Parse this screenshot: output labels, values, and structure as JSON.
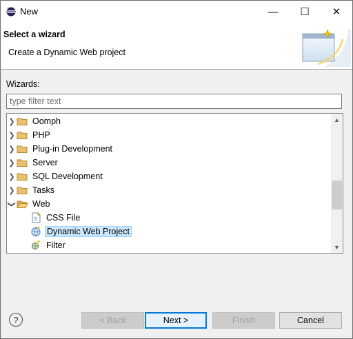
{
  "window": {
    "title": "New",
    "minimize": "—",
    "maximize": "☐",
    "close": "✕"
  },
  "banner": {
    "title": "Select a wizard",
    "message": "Create a Dynamic Web project"
  },
  "wizards_label": "Wizards:",
  "filter": {
    "placeholder": "type filter text",
    "value": ""
  },
  "tree": {
    "items": [
      {
        "label": "Oomph",
        "expanded": false,
        "icon": "folder-icon"
      },
      {
        "label": "PHP",
        "expanded": false,
        "icon": "folder-icon"
      },
      {
        "label": "Plug-in Development",
        "expanded": false,
        "icon": "folder-icon"
      },
      {
        "label": "Server",
        "expanded": false,
        "icon": "folder-icon"
      },
      {
        "label": "SQL Development",
        "expanded": false,
        "icon": "folder-icon"
      },
      {
        "label": "Tasks",
        "expanded": false,
        "icon": "folder-icon"
      },
      {
        "label": "Web",
        "expanded": true,
        "icon": "open-folder-icon"
      },
      {
        "label": "CSS File",
        "icon": "css-file-icon"
      },
      {
        "label": "Dynamic Web Project",
        "icon": "web-project-icon",
        "selected": true
      },
      {
        "label": "Filter",
        "icon": "filter-wizard-icon"
      }
    ]
  },
  "buttons": {
    "back": "< Back",
    "next": "Next >",
    "finish": "Finish",
    "cancel": "Cancel"
  },
  "help_label": "?"
}
